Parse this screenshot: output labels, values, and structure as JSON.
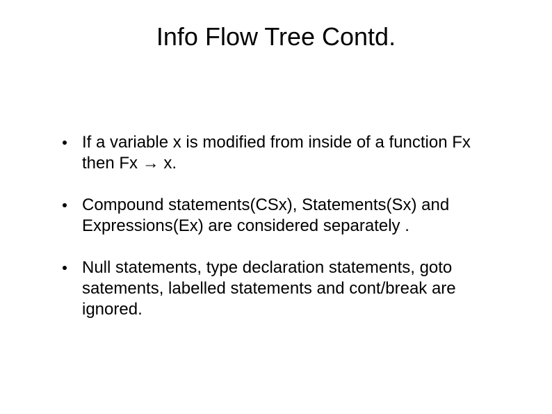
{
  "title": "Info Flow Tree Contd.",
  "bullets": [
    "If a variable x is modified from inside of a function Fx then Fx → x.",
    "Compound statements(CSx), Statements(Sx) and Expressions(Ex) are considered separately .",
    "Null statements, type declaration statements, goto satements, labelled statements and cont/break are ignored."
  ]
}
